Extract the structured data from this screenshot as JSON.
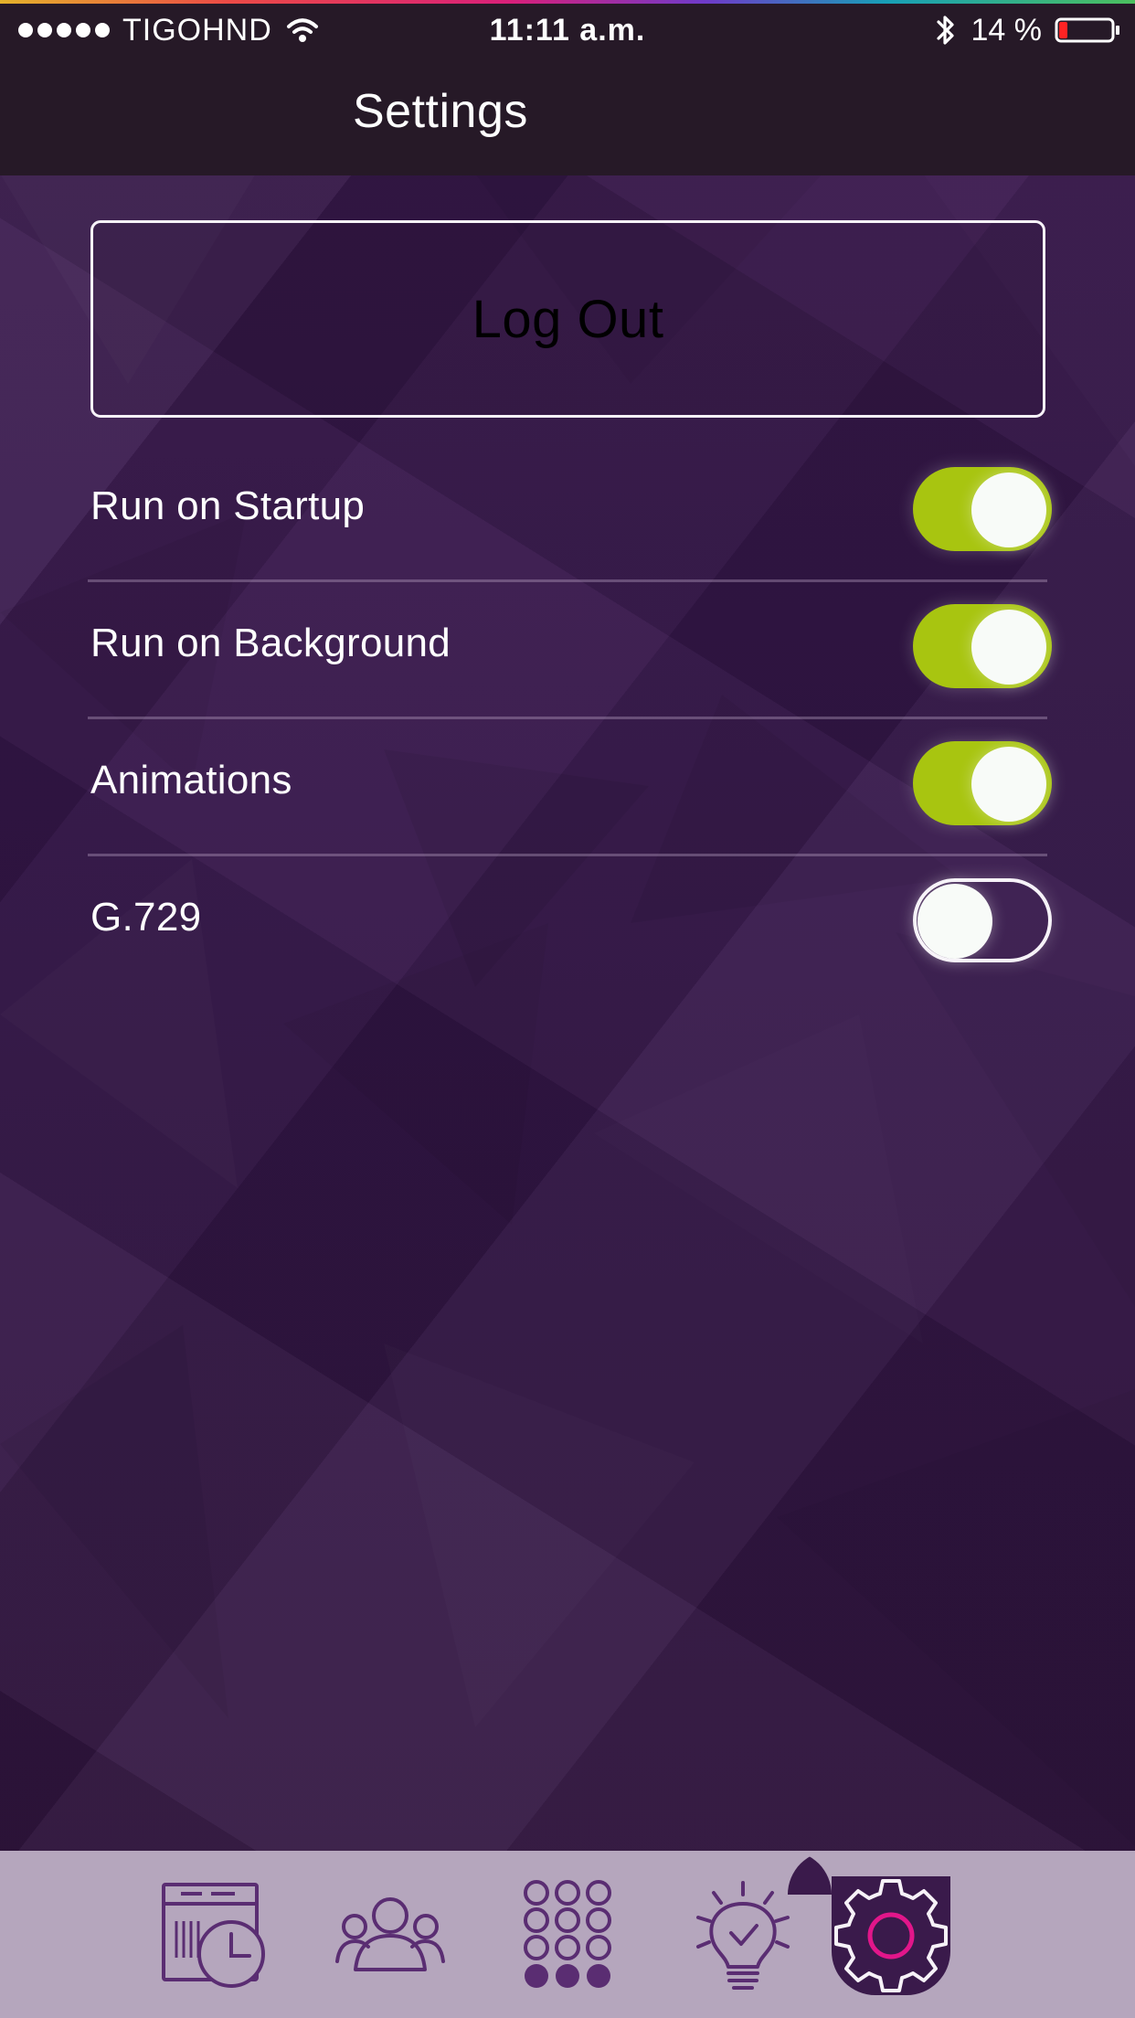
{
  "status_bar": {
    "carrier": "TIGOHND",
    "time": "11:11 a.m.",
    "battery": "14 %"
  },
  "header": {
    "title": "Settings"
  },
  "actions": {
    "logout_label": "Log Out"
  },
  "settings": [
    {
      "label": "Run on Startup",
      "state": "on"
    },
    {
      "label": "Run on Background",
      "state": "on"
    },
    {
      "label": "Animations",
      "state": "on"
    },
    {
      "label": "G.729",
      "state": "off"
    }
  ],
  "tab_bar": {
    "tabs": [
      {
        "name": "history",
        "icon": "calendar-clock-icon",
        "selected": false
      },
      {
        "name": "contacts",
        "icon": "people-icon",
        "selected": false
      },
      {
        "name": "keypad",
        "icon": "dialpad-icon",
        "selected": false
      },
      {
        "name": "tips",
        "icon": "lightbulb-check-icon",
        "selected": false
      },
      {
        "name": "settings",
        "icon": "gear-icon",
        "selected": true
      }
    ]
  },
  "colors": {
    "background": "#3b1a4e",
    "header": "#261927",
    "toggle_on": "#a8c510",
    "tabbar": "#b5a6bd",
    "selected_tab": "#3a1a4b",
    "accent": "#e2168a"
  }
}
